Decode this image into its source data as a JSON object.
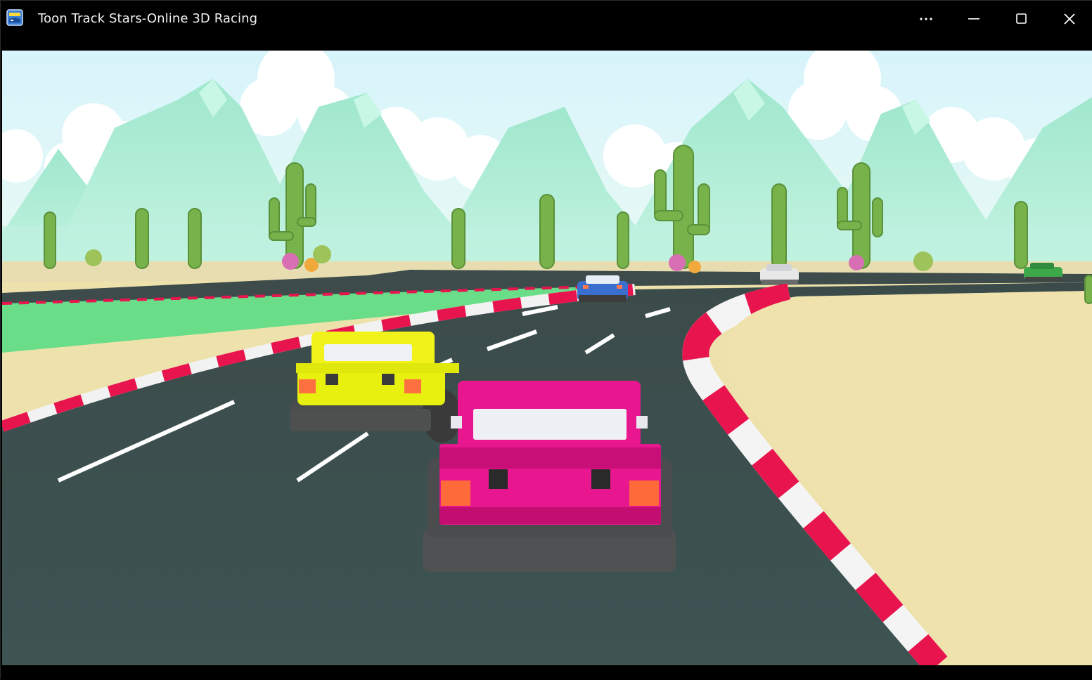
{
  "window": {
    "title": "Toon Track Stars-Online 3D Racing",
    "app_icon": "game-app-icon",
    "controls": {
      "more_icon": "more-options-icon",
      "minimize_icon": "minimize-icon",
      "maximize_icon": "maximize-icon",
      "close_icon": "close-icon"
    }
  },
  "scene": {
    "player_car_color": "#e8168f",
    "opponent_cars": [
      {
        "name": "yellow-car",
        "color": "#eef20f"
      },
      {
        "name": "blue-car",
        "color": "#3a6fd0"
      },
      {
        "name": "white-car",
        "color": "#e8e8e8"
      },
      {
        "name": "green-car",
        "color": "#3ca84a"
      }
    ],
    "colors": {
      "sky": "#dff6fb",
      "mountains": "#a9ecd3",
      "grass": "#69dd88",
      "sand": "#efe2ad",
      "road": "#3d5250",
      "kerb_red": "#e8144e",
      "kerb_white": "#f4f4f4"
    }
  }
}
